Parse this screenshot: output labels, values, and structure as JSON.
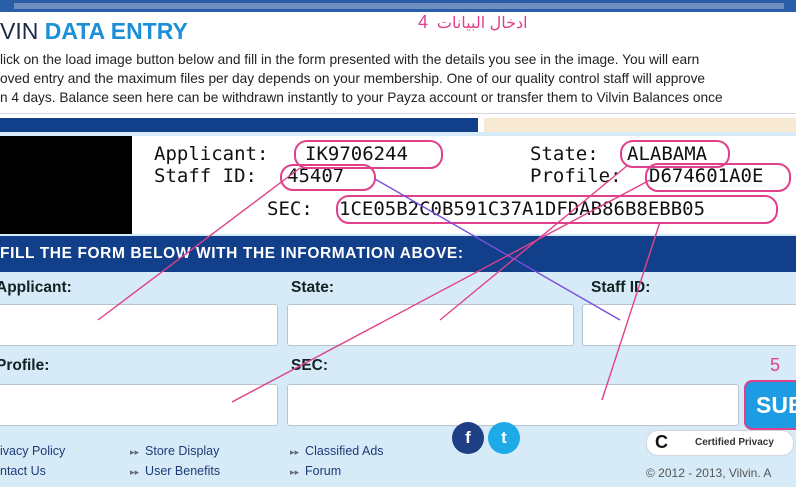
{
  "header": {
    "title_prefix": "VIN",
    "title_accent": "DATA ENTRY",
    "step4_number": "4",
    "step4_label": "ادخال البيانات"
  },
  "intro_lines": [
    "lick on the load image button below and fill in the form presented with the details you see in the image. You will earn",
    "oved entry and the maximum files per day depends on your membership. One of our quality control staff will approve",
    "n 4 days. Balance seen here can be withdrawn instantly to your Payza account or transfer them to Vilvin Balances once"
  ],
  "card": {
    "applicant_label": "Applicant:",
    "applicant_value": "IK9706244",
    "staff_label": "Staff ID:",
    "staff_value": "45407",
    "state_label": "State:",
    "state_value": "ALABAMA",
    "profile_label": "Profile:",
    "profile_value": "D674601A0E",
    "sec_label": "SEC:",
    "sec_value": "1CE05B2C0B591C37A1DFDAB86B8EBB05"
  },
  "form": {
    "banner": "FILL THE FORM BELOW WITH THE INFORMATION ABOVE:",
    "applicant_label": "Applicant:",
    "state_label": "State:",
    "staff_label": "Staff ID:",
    "profile_label": "Profile:",
    "sec_label": "SEC:",
    "applicant_value": "",
    "state_value": "",
    "staff_value": "",
    "profile_value": "",
    "sec_value": "",
    "submit_label": "SUB",
    "step5_number": "5"
  },
  "footer": {
    "links": [
      "ivacy Policy",
      "ntact Us",
      "Store Display",
      "User Benefits",
      "Classified Ads",
      "Forum"
    ],
    "social_icons": [
      "facebook-icon",
      "twitter-icon"
    ],
    "badge_text": "Certified Privacy",
    "copyright": "© 2012 - 2013, Vilvin. A"
  },
  "colors": {
    "navy_bar": "#123f8a",
    "form_background": "#d6ebf7",
    "accent_blue": "#1c8fd8",
    "annotation_pink": "#e0408a",
    "annotation_purple": "#7a4ee0",
    "submit_blue": "#1d9be3"
  }
}
